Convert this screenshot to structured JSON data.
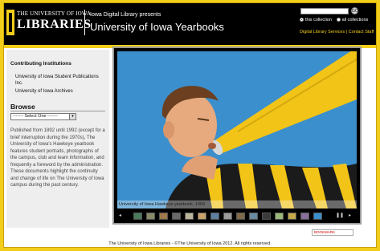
{
  "header": {
    "logo_top": "THE UNIVERSITY OF IOWA",
    "logo_main": "LIBRARIES",
    "presents": "Iowa Digital Library presents",
    "title": "University of Iowa Yearbooks"
  },
  "search": {
    "placeholder": "",
    "go_label": "GO",
    "radio_this": "this collection",
    "radio_all": "all collections"
  },
  "links": {
    "services": "Digital Library Services",
    "separator": "|",
    "contact": "Contact Staff"
  },
  "sidebar": {
    "heading": "Contributing Institutions",
    "institutions": [
      "University of Iowa Student Publications Inc.",
      "University of Iowa Archives"
    ],
    "browse": "Browse",
    "select_value": "------- Select One -------",
    "description": "Published from 1892 until 1992 (except for a brief interruption during the 1970s), The University of Iowa's Hawkeye yearbook features student portraits, photographs of the campus, club and team information, and frequently a foreword by the administration. These documents highlight the continuity and change of life on The University of Iowa campus during the past century."
  },
  "viewer": {
    "caption": "University of Iowa Hawkeye yearbook, 1969",
    "prev": "◂",
    "next": "▸"
  },
  "share": {
    "label": "BOOKMARK"
  },
  "footer": {
    "text": "The University of Iowa Libraries - ©The University of Iowa 2012. All rights reserved."
  },
  "colors": {
    "brand_gold": "#f2ce1a",
    "header_black": "#000000",
    "sky_blue": "#2f89c9"
  }
}
